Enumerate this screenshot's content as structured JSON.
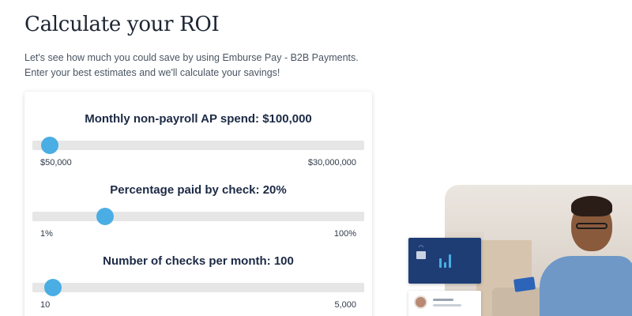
{
  "header": {
    "title": "Calculate your ROI",
    "intro": "Let's see how much you could save by using Emburse Pay - B2B Payments. Enter your best estimates and we'll calculate your savings!"
  },
  "calculator": {
    "sliders": [
      {
        "label": "Monthly non-payroll AP spend: $100,000",
        "min_label": "$50,000",
        "max_label": "$30,000,000",
        "value_fraction": 0.04
      },
      {
        "label": "Percentage paid by check: 20%",
        "min_label": "1%",
        "max_label": "100%",
        "value_fraction": 0.21
      },
      {
        "label": "Number of checks per month: 100",
        "min_label": "10",
        "max_label": "5,000",
        "value_fraction": 0.05
      }
    ]
  },
  "colors": {
    "accent": "#4aaee4",
    "track": "#e6e6e6",
    "card_brand": "#1f3d75"
  }
}
